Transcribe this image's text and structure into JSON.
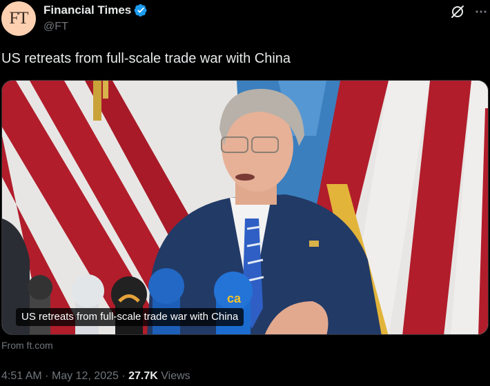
{
  "account": {
    "avatar_text": "FT",
    "display_name": "Financial Times",
    "handle": "@FT",
    "verified": true
  },
  "tweet": {
    "text": "US retreats from full-scale trade war with China"
  },
  "card": {
    "headline": "US retreats from full-scale trade war with China",
    "source": "From ft.com"
  },
  "meta": {
    "time": "4:51 AM",
    "separator": "·",
    "date": "May 12, 2025",
    "views_count": "27.7K",
    "views_label": "Views"
  },
  "icons": {
    "verified": "verified-badge-icon",
    "grok": "grok-icon",
    "more": "more-options-icon"
  },
  "colors": {
    "background": "#000000",
    "text": "#e7e9ea",
    "muted": "#71767b",
    "verified_blue": "#1d9bf0",
    "ft_avatar": "#fcd0b1"
  }
}
